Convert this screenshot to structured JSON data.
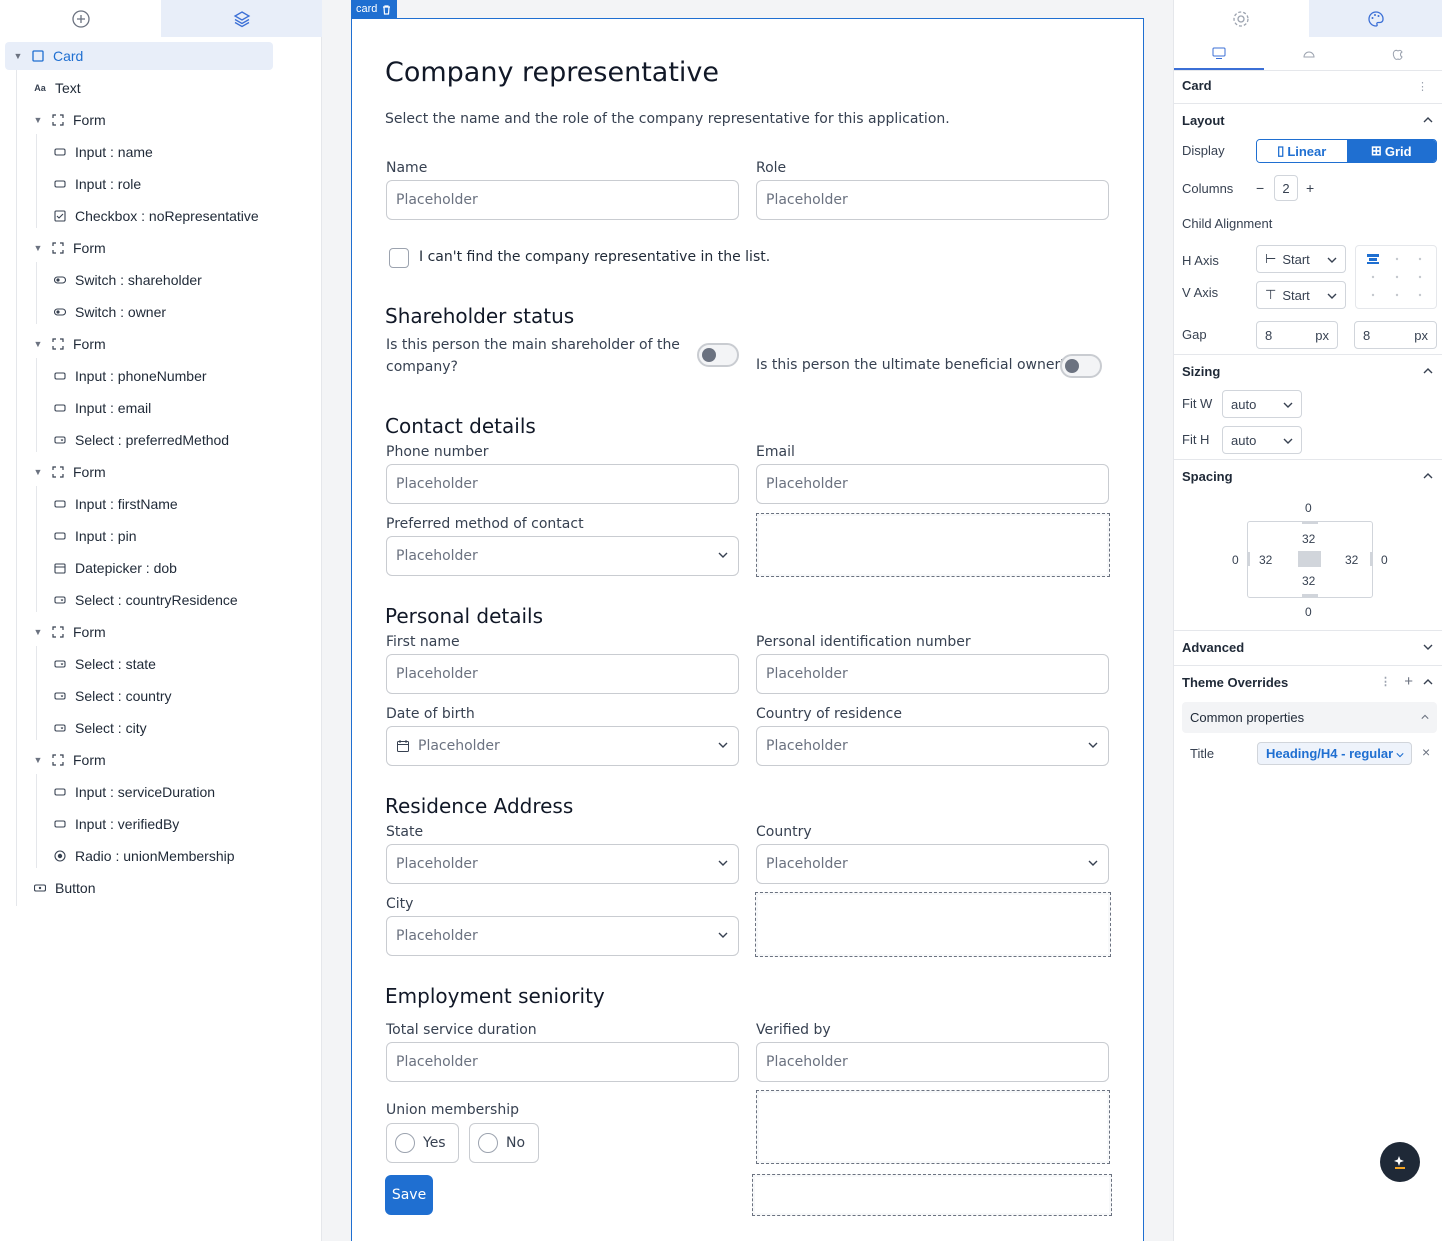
{
  "tree": {
    "items": [
      {
        "label": "Card",
        "icon": "square-icon"
      },
      {
        "label": "Text",
        "icon": "text-icon"
      },
      {
        "label": "Form",
        "icon": "form-icon"
      },
      {
        "label": "Input : name",
        "icon": "input-icon"
      },
      {
        "label": "Input : role",
        "icon": "input-icon"
      },
      {
        "label": "Checkbox : noRepresentative",
        "icon": "checkbox-icon"
      },
      {
        "label": "Form",
        "icon": "form-icon"
      },
      {
        "label": "Switch : shareholder",
        "icon": "switch-icon"
      },
      {
        "label": "Switch : owner",
        "icon": "switch-icon"
      },
      {
        "label": "Form",
        "icon": "form-icon"
      },
      {
        "label": "Input : phoneNumber",
        "icon": "input-icon"
      },
      {
        "label": "Input : email",
        "icon": "input-icon"
      },
      {
        "label": "Select : preferredMethod",
        "icon": "select-icon"
      },
      {
        "label": "Form",
        "icon": "form-icon"
      },
      {
        "label": "Input : firstName",
        "icon": "input-icon"
      },
      {
        "label": "Input : pin",
        "icon": "input-icon"
      },
      {
        "label": "Datepicker : dob",
        "icon": "calendar-icon"
      },
      {
        "label": "Select : countryResidence",
        "icon": "select-icon"
      },
      {
        "label": "Form",
        "icon": "form-icon"
      },
      {
        "label": "Select : state",
        "icon": "select-icon"
      },
      {
        "label": "Select : country",
        "icon": "select-icon"
      },
      {
        "label": "Select : city",
        "icon": "select-icon"
      },
      {
        "label": "Form",
        "icon": "form-icon"
      },
      {
        "label": "Input : serviceDuration",
        "icon": "input-icon"
      },
      {
        "label": "Input : verifiedBy",
        "icon": "input-icon"
      },
      {
        "label": "Radio : unionMembership",
        "icon": "radio-icon"
      },
      {
        "label": "Button",
        "icon": "button-icon"
      }
    ]
  },
  "canvas": {
    "tag": "card",
    "title": "Company representative",
    "description": "Select the name and the role of the company representative for this application.",
    "placeholder": "Placeholder",
    "name_label": "Name",
    "role_label": "Role",
    "checkbox_label": "I can't find the company representative in the list.",
    "shareholder_title": "Shareholder status",
    "shareholder_q1": "Is this person the main shareholder of the company?",
    "shareholder_q2": "Is this person the ultimate beneficial owner?",
    "contact_title": "Contact details",
    "phone_label": "Phone number",
    "email_label": "Email",
    "preferred_label": "Preferred method of contact",
    "personal_title": "Personal details",
    "first_name_label": "First name",
    "pin_label": "Personal identification number",
    "dob_label": "Date of birth",
    "country_res_label": "Country of residence",
    "address_title": "Residence Address",
    "state_label": "State",
    "country_label": "Country",
    "city_label": "City",
    "employment_title": "Employment seniority",
    "duration_label": "Total service duration",
    "verified_label": "Verified by",
    "union_label": "Union membership",
    "yes": "Yes",
    "no": "No",
    "save": "Save"
  },
  "panel": {
    "component": "Card",
    "layout": "Layout",
    "display": "Display",
    "linear": "Linear",
    "grid": "Grid",
    "columns": "Columns",
    "columns_value": "2",
    "minus": "−",
    "plus": "+",
    "child_alignment": "Child Alignment",
    "h_axis": "H Axis",
    "h_axis_value": "Start",
    "v_axis": "V Axis",
    "v_axis_value": "Start",
    "gap": "Gap",
    "gap1": "8",
    "gap2": "8",
    "px": "px",
    "sizing": "Sizing",
    "fit_w": "Fit W",
    "fit_w_value": "auto",
    "fit_h": "Fit H",
    "fit_h_value": "auto",
    "spacing": "Spacing",
    "margin_top": "0",
    "margin_left": "0",
    "margin_right": "0",
    "margin_bottom": "0",
    "pad_top": "32",
    "pad_left": "32",
    "pad_right": "32",
    "pad_bottom": "32",
    "advanced": "Advanced",
    "theme_overrides": "Theme Overrides",
    "common_properties": "Common properties",
    "title_label": "Title",
    "title_value": "Heading/H4 - regular"
  },
  "colors": {
    "accent": "#1f6fd1",
    "selected_bg": "#e8eef9"
  }
}
